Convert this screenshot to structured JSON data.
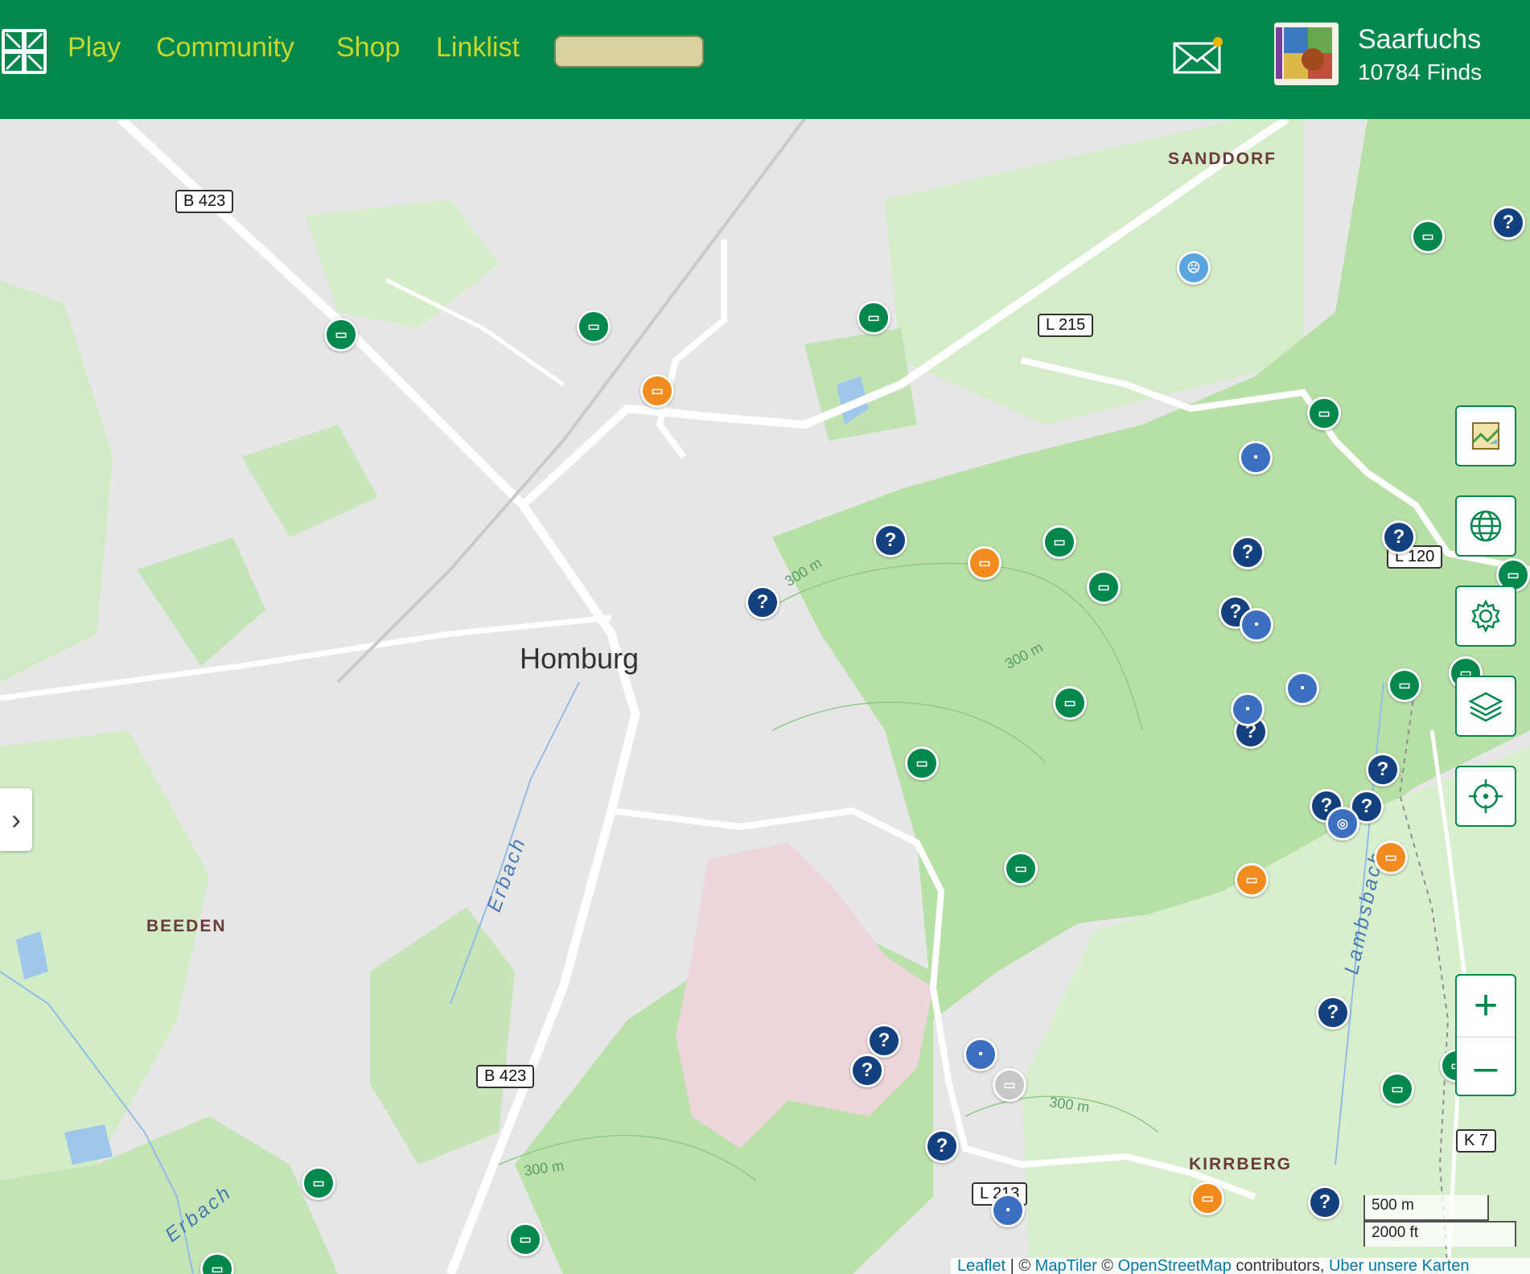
{
  "header": {
    "nav": [
      "Play",
      "Community",
      "Shop",
      "Linklist"
    ],
    "username": "Saarfuchs",
    "finds": "10784 Finds",
    "avatar_text": "Saarfuchs"
  },
  "map": {
    "city": "Homburg",
    "districts": [
      "SANDDORF",
      "BEEDEN",
      "KIRRBERG"
    ],
    "waterways": [
      "Erbach",
      "Erbach",
      "Lambsbach"
    ],
    "contours": [
      "300 m",
      "300 m",
      "300 m",
      "300 m"
    ],
    "roads": [
      "B 423",
      "B 423",
      "L 215",
      "L 120",
      "L 213",
      "K 7"
    ],
    "scale": {
      "metric": "500 m",
      "imperial": "2000 ft"
    },
    "attribution": {
      "leaflet": "Leaflet",
      "sep": " | © ",
      "maptiler": "MapTiler",
      "copy": " © ",
      "osm": "OpenStreetMap",
      "contributors": " contributors, ",
      "about": "Über unsere Karten"
    }
  },
  "controls": [
    "map-style-icon",
    "globe-icon",
    "settings-icon",
    "layers-icon",
    "locate-icon",
    "zoom-in-icon",
    "zoom-out-icon"
  ],
  "colors": {
    "brand_green": "#02874d",
    "nav_text": "#c6d82b",
    "traditional": "#02874d",
    "mystery": "#13407e",
    "multi": "#f28b1d",
    "event": "#3d6fc0"
  }
}
